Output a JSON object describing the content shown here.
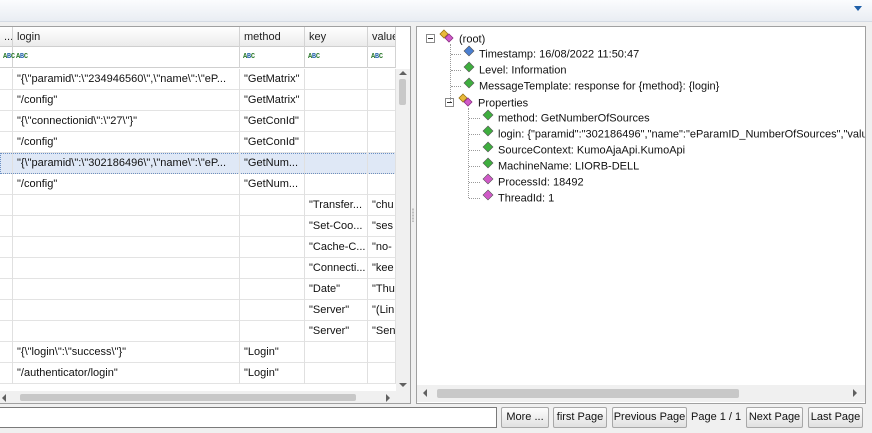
{
  "grid": {
    "columns": [
      {
        "key": "c0",
        "label": "..."
      },
      {
        "key": "c1",
        "label": "login"
      },
      {
        "key": "c2",
        "label": "method"
      },
      {
        "key": "c3",
        "label": "key"
      },
      {
        "key": "c4",
        "label": "value"
      }
    ],
    "filter_icon_text": "ABC",
    "rows": [
      {
        "login": "\"{\\\"paramid\\\":\\\"234946560\\\",\\\"name\\\":\\\"eP...",
        "method": "\"GetMatrix\"",
        "key": "",
        "value": ""
      },
      {
        "login": "\"/config\"",
        "method": "\"GetMatrix\"",
        "key": "",
        "value": ""
      },
      {
        "login": "\"{\\\"connectionid\\\":\\\"27\\\"}\"",
        "method": "\"GetConId\"",
        "key": "",
        "value": ""
      },
      {
        "login": "\"/config\"",
        "method": "\"GetConId\"",
        "key": "",
        "value": ""
      },
      {
        "login": "\"{\\\"paramid\\\":\\\"302186496\\\",\\\"name\\\":\\\"eP...",
        "method": "\"GetNum...",
        "key": "",
        "value": "",
        "selected": true
      },
      {
        "login": "\"/config\"",
        "method": "\"GetNum...",
        "key": "",
        "value": ""
      },
      {
        "login": "",
        "method": "",
        "key": "\"Transfer...",
        "value": "\"chu"
      },
      {
        "login": "",
        "method": "",
        "key": "\"Set-Coo...",
        "value": "\"ses"
      },
      {
        "login": "",
        "method": "",
        "key": "\"Cache-C...",
        "value": "\"no-"
      },
      {
        "login": "",
        "method": "",
        "key": "\"Connecti...",
        "value": "\"kee"
      },
      {
        "login": "",
        "method": "",
        "key": "\"Date\"",
        "value": "\"Thu"
      },
      {
        "login": "",
        "method": "",
        "key": "\"Server\"",
        "value": "\"(Lin"
      },
      {
        "login": "",
        "method": "",
        "key": "\"Server\"",
        "value": "\"Sen"
      },
      {
        "login": "\"{\\\"login\\\":\\\"success\\\"}\"",
        "method": "\"Login\"",
        "key": "",
        "value": ""
      },
      {
        "login": "\"/authenticator/login\"",
        "method": "\"Login\"",
        "key": "",
        "value": ""
      }
    ]
  },
  "tree": {
    "root": "(root)",
    "nodes": [
      {
        "label": "Timestamp: 16/08/2022 11:50:47",
        "icon": "date-icon",
        "color": "#4a7fd0"
      },
      {
        "label": "Level: Information",
        "icon": "string-icon",
        "color": "#3fae3f"
      },
      {
        "label": "MessageTemplate: response for {method}: {login}",
        "icon": "string-icon",
        "color": "#3fae3f"
      }
    ],
    "properties_label": "Properties",
    "properties": [
      {
        "label": "method: GetNumberOfSources",
        "icon": "string-icon",
        "color": "#3fae3f"
      },
      {
        "label": "login: {\"paramid\":\"302186496\",\"name\":\"eParamID_NumberOfSources\",\"valu",
        "icon": "string-icon",
        "color": "#3fae3f"
      },
      {
        "label": "SourceContext: KumoAjaApi.KumoApi",
        "icon": "string-icon",
        "color": "#3fae3f"
      },
      {
        "label": "MachineName: LIORB-DELL",
        "icon": "string-icon",
        "color": "#3fae3f"
      },
      {
        "label": "ProcessId: 18492",
        "icon": "number-icon",
        "color": "#d05ac8"
      },
      {
        "label": "ThreadId: 1",
        "icon": "number-icon",
        "color": "#d05ac8"
      }
    ]
  },
  "pager": {
    "search_value": "",
    "more_label": "More ...",
    "first_label": "first Page",
    "prev_label": "Previous Page",
    "page_info": "Page 1 / 1",
    "next_label": "Next Page",
    "last_label": "Last Page"
  }
}
